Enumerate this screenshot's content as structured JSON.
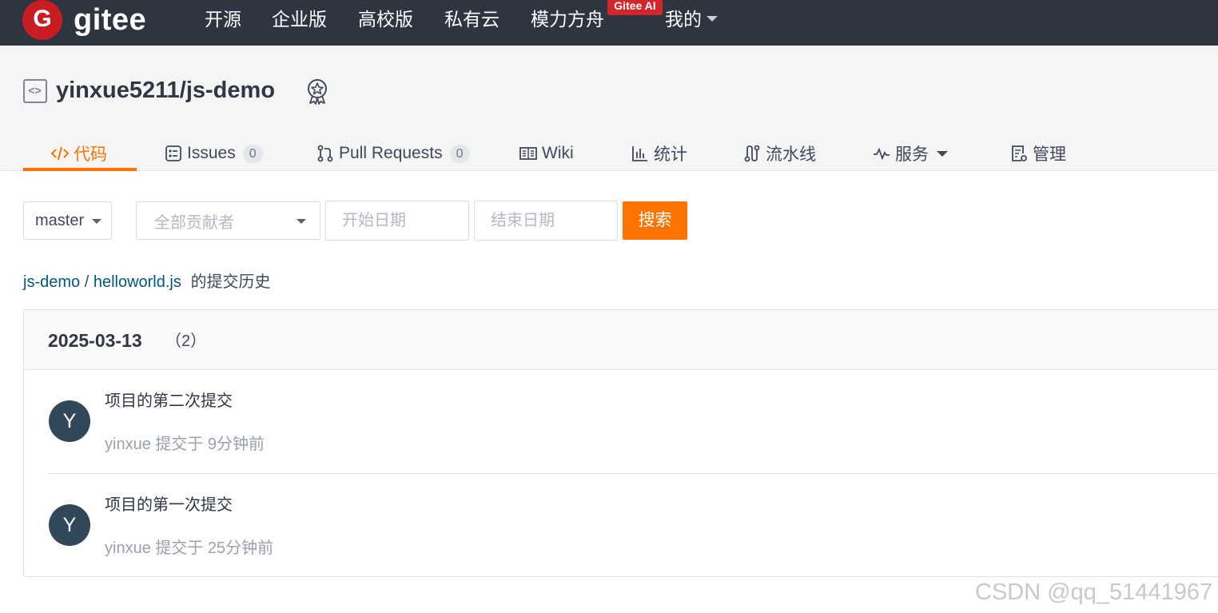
{
  "topnav": {
    "logo_text": "gitee",
    "logo_letter": "G",
    "items": [
      "开源",
      "企业版",
      "高校版",
      "私有云",
      "模力方舟",
      "我的"
    ],
    "ai_badge": "Gitee AI"
  },
  "repo": {
    "title": "yinxue5211/js-demo"
  },
  "tabs": {
    "code": "代码",
    "issues": "Issues",
    "issues_count": "0",
    "pulls": "Pull Requests",
    "pulls_count": "0",
    "wiki": "Wiki",
    "stats": "统计",
    "pipeline": "流水线",
    "services": "服务",
    "manage": "管理"
  },
  "filters": {
    "branch": "master",
    "contributors_placeholder": "全部贡献者",
    "start_placeholder": "开始日期",
    "end_placeholder": "结束日期",
    "search_label": "搜索"
  },
  "breadcrumb": {
    "repo": "js-demo",
    "sep": "/",
    "file": "helloworld.js",
    "suffix": "的提交历史"
  },
  "history": {
    "date": "2025-03-13",
    "count": "（2）",
    "commits": [
      {
        "avatar": "Y",
        "message": "项目的第二次提交",
        "meta": "yinxue 提交于 9分钟前"
      },
      {
        "avatar": "Y",
        "message": "项目的第一次提交",
        "meta": "yinxue 提交于 25分钟前"
      }
    ]
  },
  "watermark": "CSDN @qq_51441967",
  "colors": {
    "nav_bg": "#2f3441",
    "accent": "#fe7300",
    "logo_red": "#c71d23",
    "avatar_bg": "#33475b",
    "link": "#005980"
  }
}
